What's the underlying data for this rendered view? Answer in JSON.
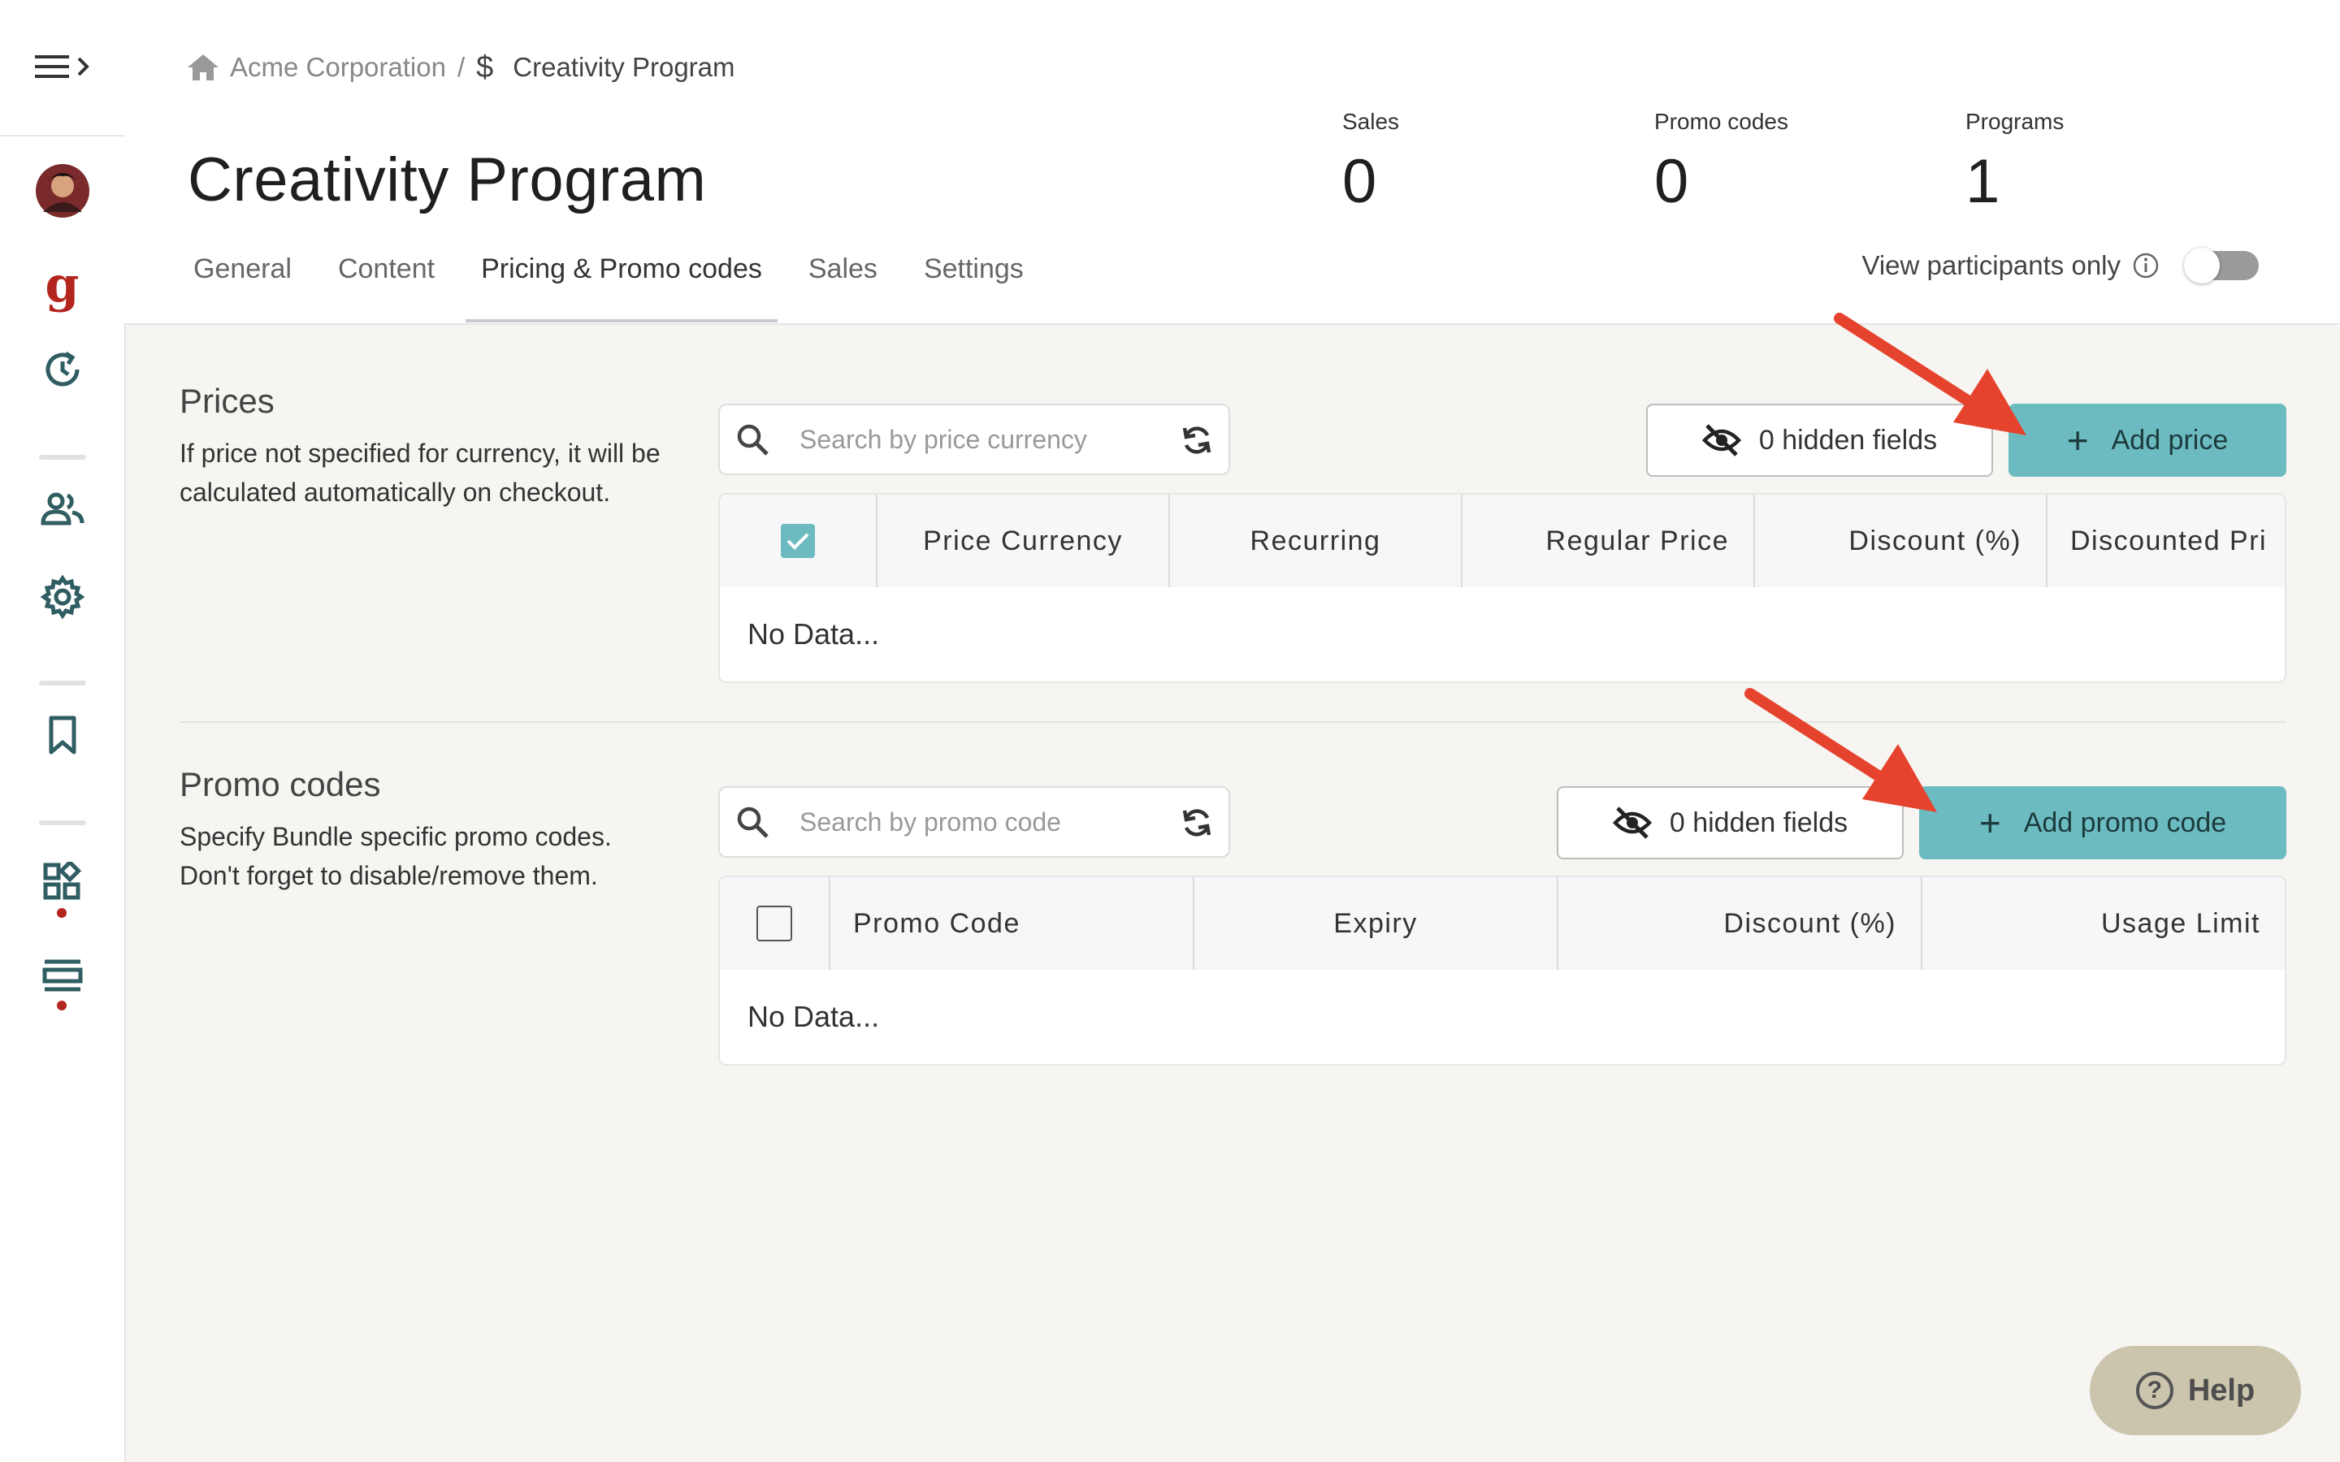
{
  "sidebar": {
    "logo_letter": "g",
    "icons": [
      "menu-icon",
      "avatar",
      "logo-g-icon",
      "history-icon",
      "users-icon",
      "settings-icon",
      "bookmark-icon",
      "apps-icon",
      "layout-icon"
    ]
  },
  "breadcrumb": {
    "root": "Acme Corporation",
    "separator": "/",
    "current": "Creativity Program"
  },
  "header": {
    "title": "Creativity Program",
    "stats": [
      {
        "label": "Sales",
        "value": "0"
      },
      {
        "label": "Promo codes",
        "value": "0"
      },
      {
        "label": "Programs",
        "value": "1"
      }
    ],
    "tabs": [
      {
        "label": "General"
      },
      {
        "label": "Content"
      },
      {
        "label": "Pricing & Promo codes",
        "active": true
      },
      {
        "label": "Sales"
      },
      {
        "label": "Settings"
      }
    ],
    "view_participants_label": "View participants only",
    "view_participants_on": false
  },
  "prices": {
    "title": "Prices",
    "description": "If price not specified for currency, it will be calculated automatically on checkout.",
    "search_placeholder": "Search by price currency",
    "hidden_fields_label": "0 hidden fields",
    "add_label": "Add price",
    "columns": [
      "Price Currency",
      "Recurring",
      "Regular Price",
      "Discount (%)",
      "Discounted Pri"
    ],
    "empty_text": "No Data..."
  },
  "promo": {
    "title": "Promo codes",
    "description": "Specify Bundle specific promo codes. Don't forget to disable/remove them.",
    "search_placeholder": "Search by promo code",
    "hidden_fields_label": "0 hidden fields",
    "add_label": "Add promo code",
    "columns": [
      "Promo Code",
      "Expiry",
      "Discount (%)",
      "Usage Limit"
    ],
    "empty_text": "No Data..."
  },
  "help": {
    "label": "Help"
  },
  "colors": {
    "accent": "#6cbbc0",
    "brand_red": "#b3261e",
    "arrow": "#e5432d",
    "icon": "#2f5d62"
  }
}
